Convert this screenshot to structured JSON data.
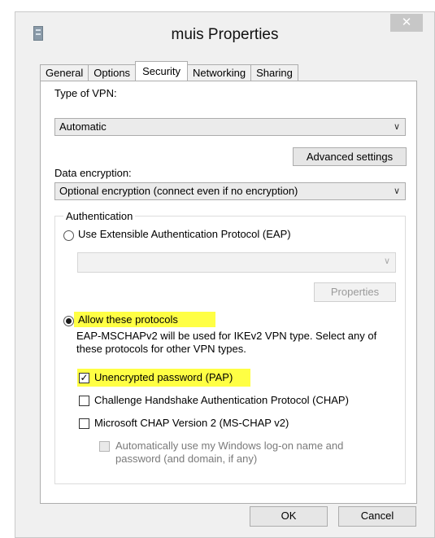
{
  "window": {
    "title": "muis Properties",
    "close_glyph": "✕"
  },
  "tabs": [
    "General",
    "Options",
    "Security",
    "Networking",
    "Sharing"
  ],
  "active_tab": "Security",
  "vpn": {
    "label": "Type of VPN:",
    "value": "Automatic",
    "arrow": "∨"
  },
  "advanced_button": "Advanced settings",
  "encryption": {
    "label": "Data encryption:",
    "value": "Optional encryption (connect even if no encryption)",
    "arrow": "∨"
  },
  "auth": {
    "legend": "Authentication",
    "eap_label": "Use Extensible Authentication Protocol (EAP)",
    "eap_select_arrow": "∨",
    "properties_button": "Properties",
    "allow_label": "Allow these protocols",
    "description": "EAP-MSCHAPv2 will be used for IKEv2 VPN type. Select any of these protocols for other VPN types.",
    "protocols": {
      "pap": {
        "label": "Unencrypted password (PAP)",
        "checked": true,
        "mark": "✓"
      },
      "chap": {
        "label": "Challenge Handshake Authentication Protocol (CHAP)",
        "checked": false
      },
      "mschap": {
        "label": "Microsoft CHAP Version 2 (MS-CHAP v2)",
        "checked": false
      },
      "auto_logon": {
        "label": "Automatically use my Windows log-on name and password (and domain, if any)",
        "checked": false,
        "disabled": true
      }
    }
  },
  "footer": {
    "ok": "OK",
    "cancel": "Cancel"
  },
  "colors": {
    "highlight": "#ffff44",
    "window_bg": "#f0f0f0",
    "close_bg": "#c7c7c7"
  }
}
